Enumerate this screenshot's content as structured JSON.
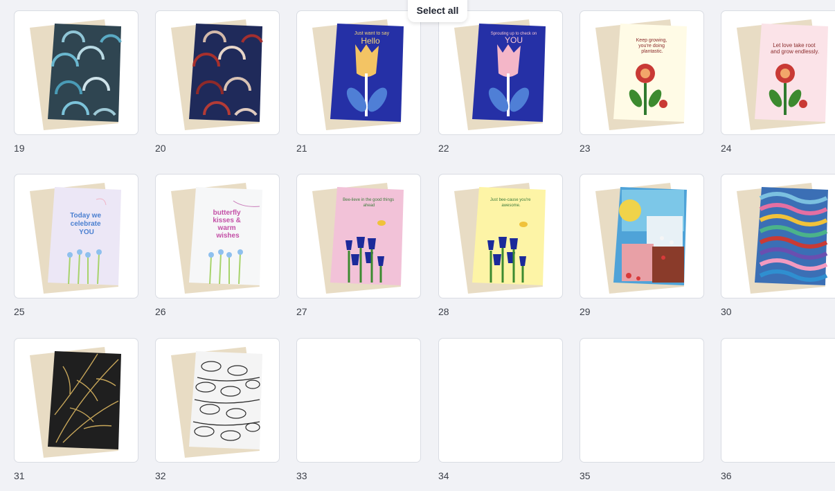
{
  "toolbar": {
    "select_all_label": "Select all"
  },
  "pages": [
    {
      "number": "19",
      "design": "arches-teal"
    },
    {
      "number": "20",
      "design": "arches-red"
    },
    {
      "number": "21",
      "design": "tulip-yellow",
      "text": "Just want to say",
      "big": "Hello"
    },
    {
      "number": "22",
      "design": "tulip-pink",
      "text": "Sprouting up to check on",
      "big": "YOU"
    },
    {
      "number": "23",
      "design": "flower-cream",
      "text": [
        "Keep growing,",
        "you're doing",
        "plantastic."
      ]
    },
    {
      "number": "24",
      "design": "flower-pink",
      "text": [
        "Let love take root",
        "and grow endlessly."
      ]
    },
    {
      "number": "25",
      "design": "celebrate",
      "text": [
        "Today we",
        "celebrate",
        "YOU"
      ]
    },
    {
      "number": "26",
      "design": "butterfly",
      "text": [
        "butterfly",
        "kisses &",
        "warm",
        "wishes"
      ]
    },
    {
      "number": "27",
      "design": "bee-pink",
      "text": [
        "Bee-lieve in the good things",
        "ahead"
      ]
    },
    {
      "number": "28",
      "design": "bee-yellow",
      "text": [
        "Just bee-cause you're",
        "awesome."
      ]
    },
    {
      "number": "29",
      "design": "abstract-garden"
    },
    {
      "number": "30",
      "design": "waves-colorful"
    },
    {
      "number": "31",
      "design": "leaves-gold"
    },
    {
      "number": "32",
      "design": "fish-lineart"
    },
    {
      "number": "33",
      "design": "blank"
    },
    {
      "number": "34",
      "design": "blank"
    },
    {
      "number": "35",
      "design": "blank"
    },
    {
      "number": "36",
      "design": "blank"
    }
  ]
}
